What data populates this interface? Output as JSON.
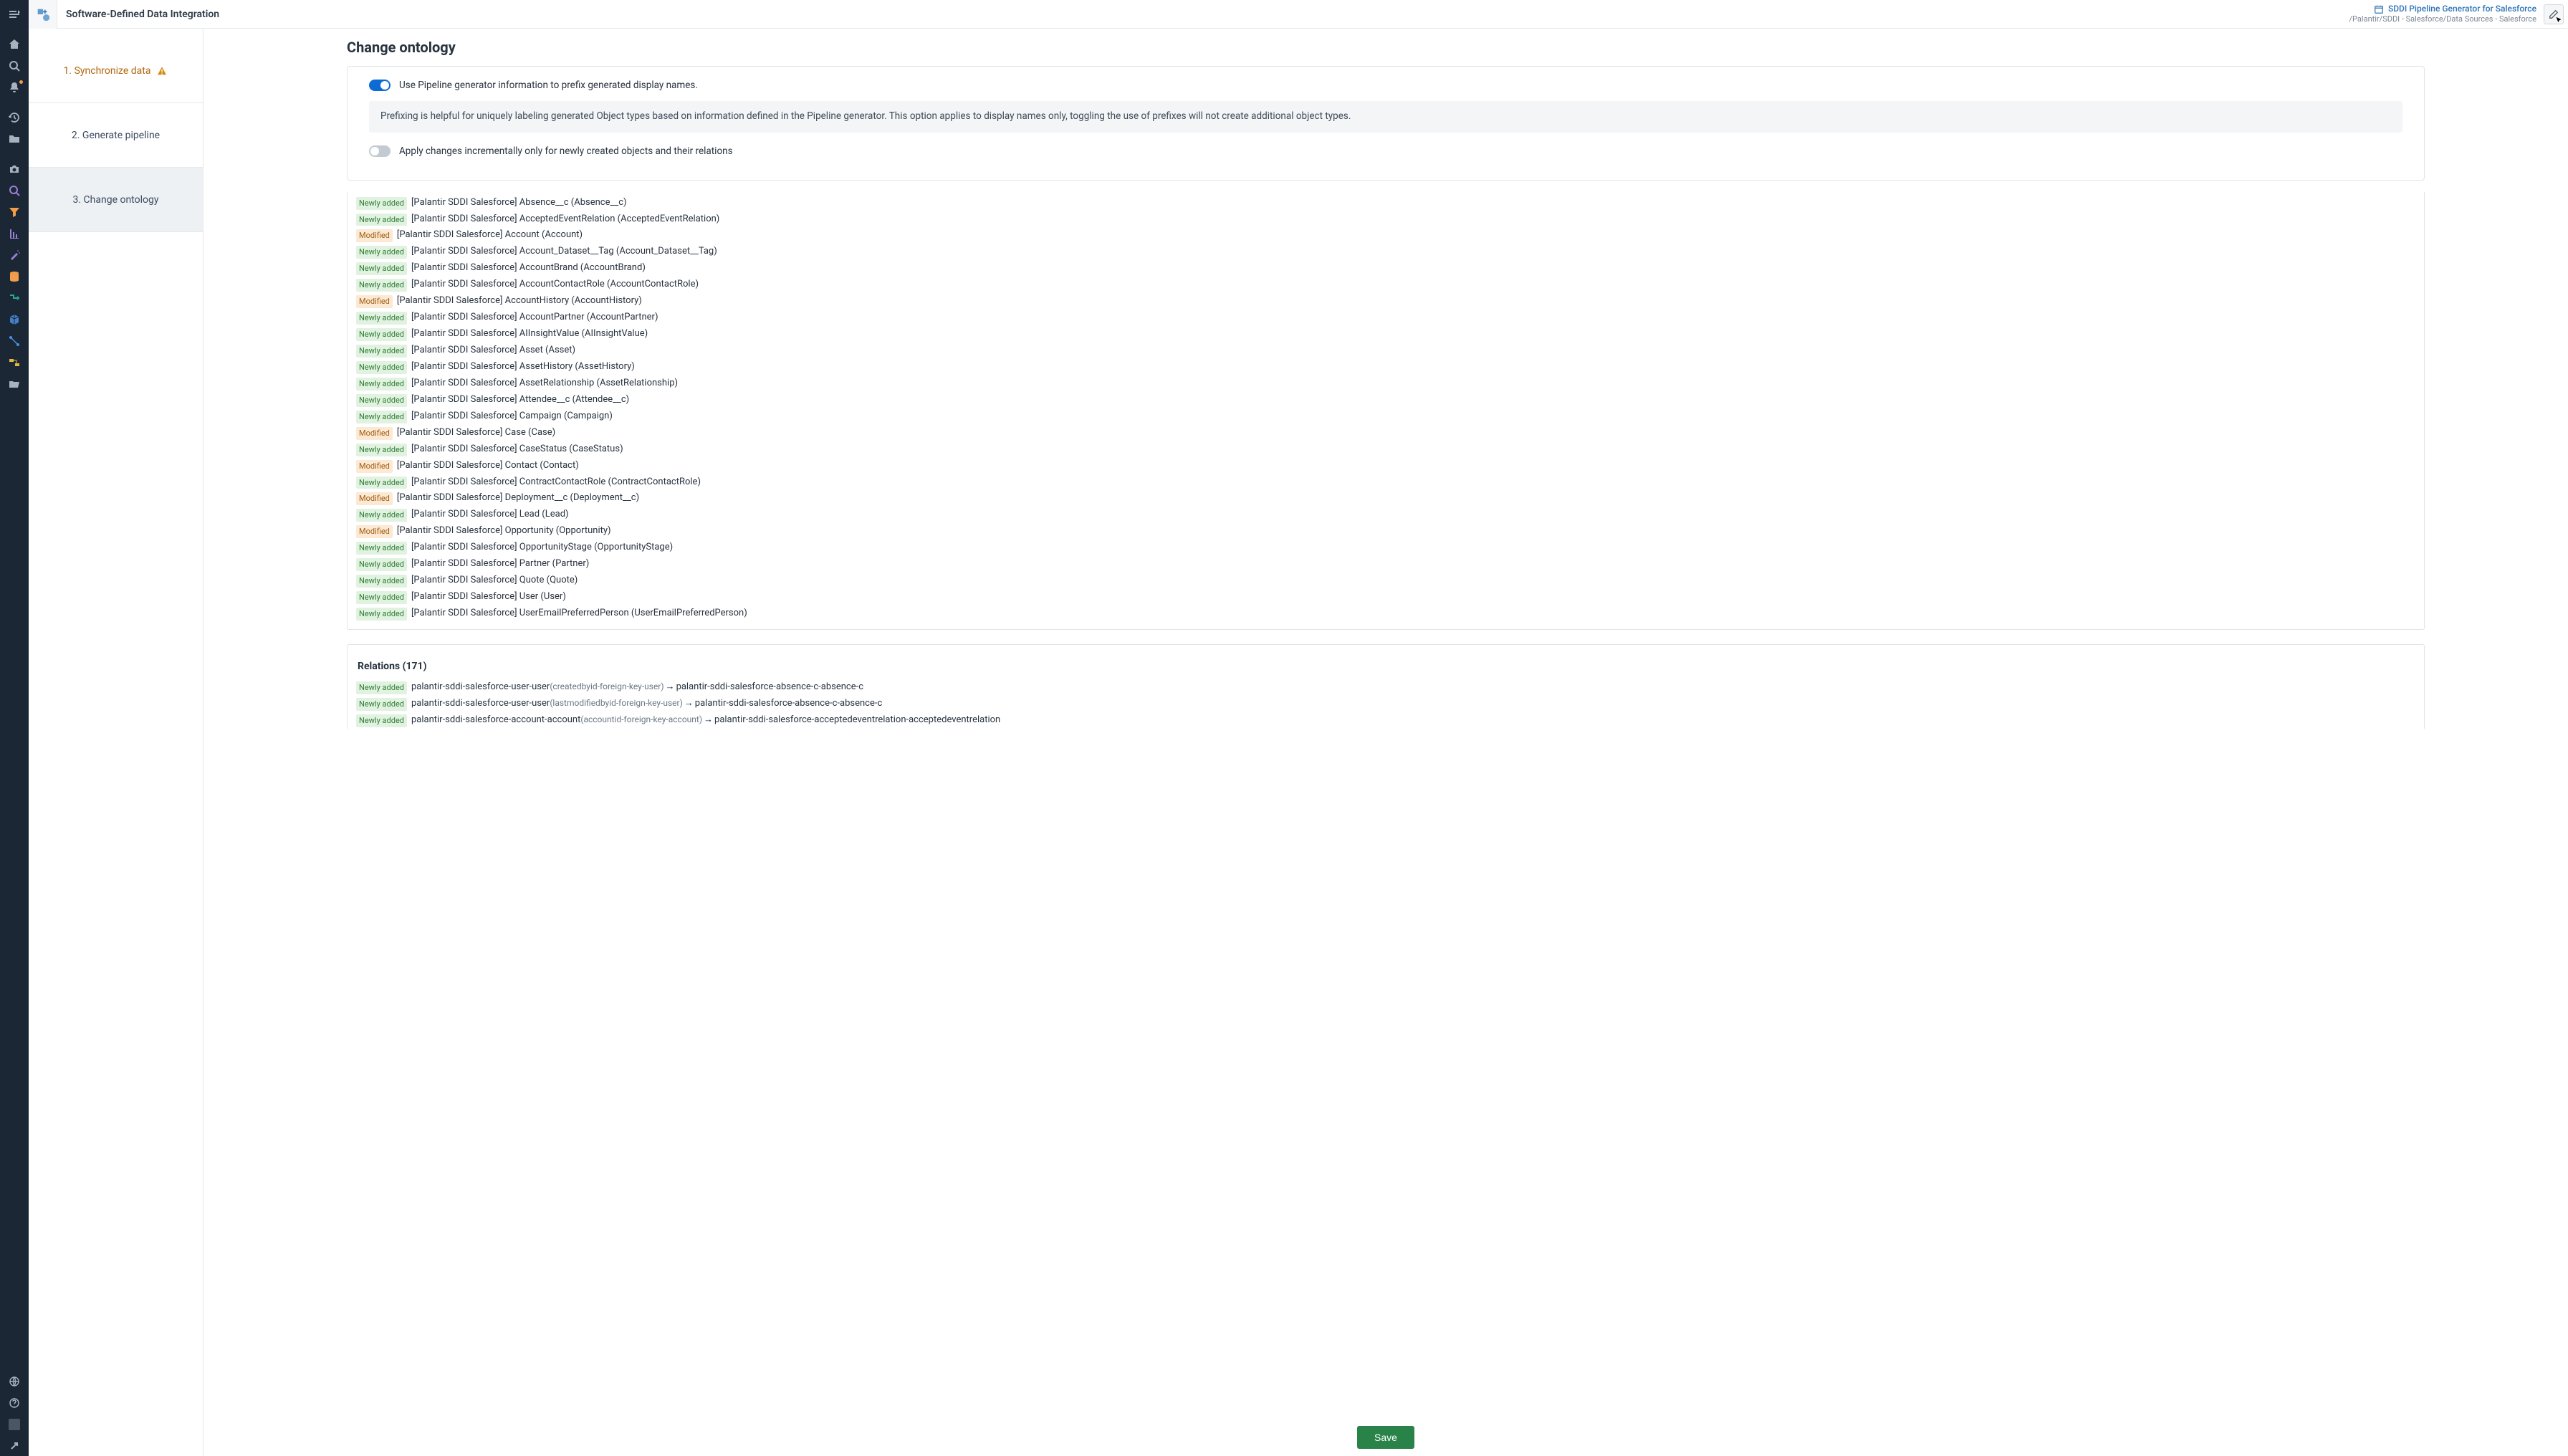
{
  "header": {
    "title": "Software-Defined Data Integration",
    "project_name": "SDDI Pipeline Generator for Salesforce",
    "project_path": "/Palantir/SDDI - Salesforce/Data Sources - Salesforce"
  },
  "steps": {
    "s1": "1. Synchronize data",
    "s2": "2. Generate pipeline",
    "s3": "3. Change ontology"
  },
  "page": {
    "heading": "Change ontology",
    "toggle1_label": "Use Pipeline generator information to prefix generated display names.",
    "info_text": "Prefixing is helpful for uniquely labeling generated Object types based on information defined in the Pipeline generator. This option applies to display names only, toggling the use of prefixes will not create additional object types.",
    "toggle2_label": "Apply changes incrementally only for newly created objects and their relations",
    "relations_heading": "Relations (171)",
    "save_label": "Save"
  },
  "badges": {
    "new": "Newly added",
    "mod": "Modified"
  },
  "object_types": [
    {
      "b": "new",
      "t": "[Palantir SDDI Salesforce] Absence__c (Absence__c)"
    },
    {
      "b": "new",
      "t": "[Palantir SDDI Salesforce] AcceptedEventRelation (AcceptedEventRelation)"
    },
    {
      "b": "mod",
      "t": "[Palantir SDDI Salesforce] Account (Account)"
    },
    {
      "b": "new",
      "t": "[Palantir SDDI Salesforce] Account_Dataset__Tag (Account_Dataset__Tag)"
    },
    {
      "b": "new",
      "t": "[Palantir SDDI Salesforce] AccountBrand (AccountBrand)"
    },
    {
      "b": "new",
      "t": "[Palantir SDDI Salesforce] AccountContactRole (AccountContactRole)"
    },
    {
      "b": "mod",
      "t": "[Palantir SDDI Salesforce] AccountHistory (AccountHistory)"
    },
    {
      "b": "new",
      "t": "[Palantir SDDI Salesforce] AccountPartner (AccountPartner)"
    },
    {
      "b": "new",
      "t": "[Palantir SDDI Salesforce] AIInsightValue (AIInsightValue)"
    },
    {
      "b": "new",
      "t": "[Palantir SDDI Salesforce] Asset (Asset)"
    },
    {
      "b": "new",
      "t": "[Palantir SDDI Salesforce] AssetHistory (AssetHistory)"
    },
    {
      "b": "new",
      "t": "[Palantir SDDI Salesforce] AssetRelationship (AssetRelationship)"
    },
    {
      "b": "new",
      "t": "[Palantir SDDI Salesforce] Attendee__c (Attendee__c)"
    },
    {
      "b": "new",
      "t": "[Palantir SDDI Salesforce] Campaign (Campaign)"
    },
    {
      "b": "mod",
      "t": "[Palantir SDDI Salesforce] Case (Case)"
    },
    {
      "b": "new",
      "t": "[Palantir SDDI Salesforce] CaseStatus (CaseStatus)"
    },
    {
      "b": "mod",
      "t": "[Palantir SDDI Salesforce] Contact (Contact)"
    },
    {
      "b": "new",
      "t": "[Palantir SDDI Salesforce] ContractContactRole (ContractContactRole)"
    },
    {
      "b": "mod",
      "t": "[Palantir SDDI Salesforce] Deployment__c (Deployment__c)"
    },
    {
      "b": "new",
      "t": "[Palantir SDDI Salesforce] Lead (Lead)"
    },
    {
      "b": "mod",
      "t": "[Palantir SDDI Salesforce] Opportunity (Opportunity)"
    },
    {
      "b": "new",
      "t": "[Palantir SDDI Salesforce] OpportunityStage (OpportunityStage)"
    },
    {
      "b": "new",
      "t": "[Palantir SDDI Salesforce] Partner (Partner)"
    },
    {
      "b": "new",
      "t": "[Palantir SDDI Salesforce] Quote (Quote)"
    },
    {
      "b": "new",
      "t": "[Palantir SDDI Salesforce] User (User)"
    },
    {
      "b": "new",
      "t": "[Palantir SDDI Salesforce] UserEmailPreferredPerson (UserEmailPreferredPerson)"
    }
  ],
  "relations": [
    {
      "b": "new",
      "from": "palantir-sddi-salesforce-user-user",
      "key": "(createdbyid-foreign-key-user)",
      "to": "palantir-sddi-salesforce-absence-c-absence-c"
    },
    {
      "b": "new",
      "from": "palantir-sddi-salesforce-user-user",
      "key": "(lastmodifiedbyid-foreign-key-user)",
      "to": "palantir-sddi-salesforce-absence-c-absence-c"
    },
    {
      "b": "new",
      "from": "palantir-sddi-salesforce-account-account",
      "key": "(accountid-foreign-key-account)",
      "to": "palantir-sddi-salesforce-acceptedeventrelation-acceptedeventrelation"
    }
  ]
}
